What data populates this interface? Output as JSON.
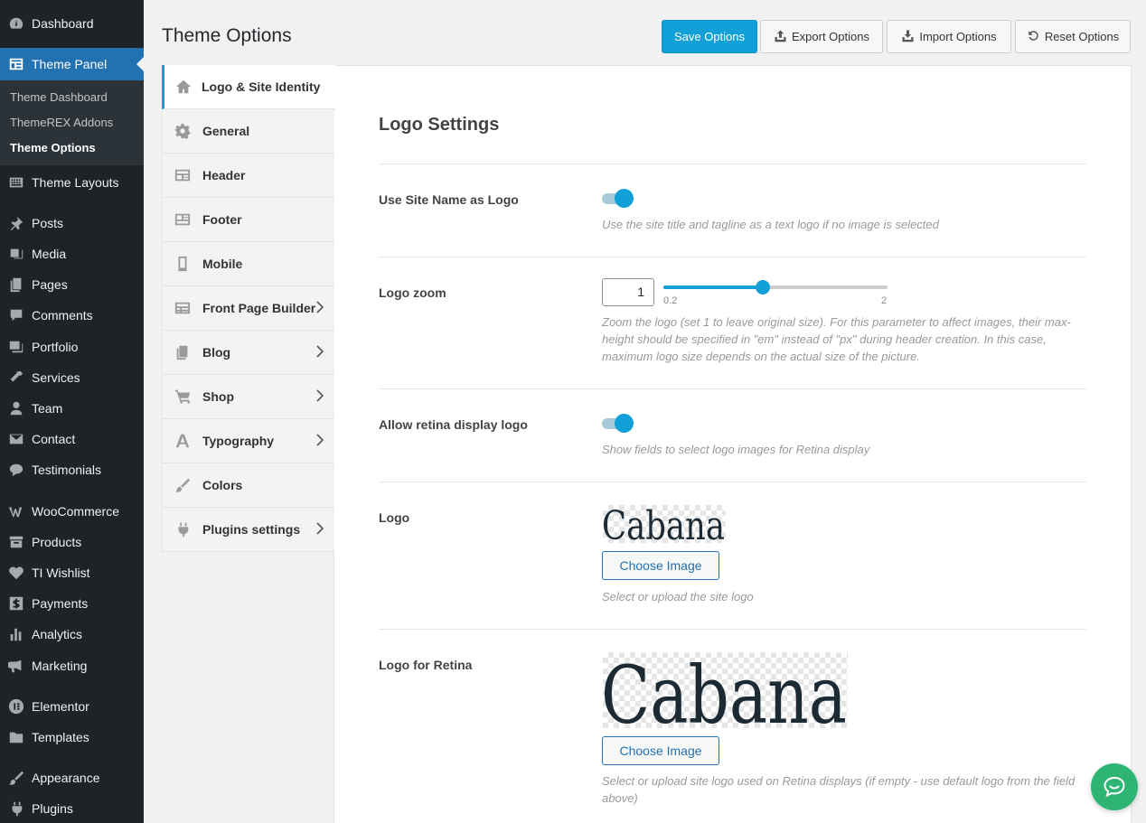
{
  "admin_menu": {
    "items": [
      {
        "label": "Dashboard",
        "icon": "dashboard-icon"
      },
      {
        "label": "Theme Panel",
        "icon": "theme-panel-icon"
      },
      {
        "label": "Theme Layouts",
        "icon": "layouts-icon"
      },
      {
        "label": "Posts",
        "icon": "pin-icon"
      },
      {
        "label": "Media",
        "icon": "media-icon"
      },
      {
        "label": "Pages",
        "icon": "pages-icon"
      },
      {
        "label": "Comments",
        "icon": "comment-icon"
      },
      {
        "label": "Portfolio",
        "icon": "portfolio-icon"
      },
      {
        "label": "Services",
        "icon": "tools-icon"
      },
      {
        "label": "Team",
        "icon": "user-icon"
      },
      {
        "label": "Contact",
        "icon": "envelope-icon"
      },
      {
        "label": "Testimonials",
        "icon": "chat-bubble-icon"
      },
      {
        "label": "WooCommerce",
        "icon": "woocommerce-icon"
      },
      {
        "label": "Products",
        "icon": "archive-icon"
      },
      {
        "label": "TI Wishlist",
        "icon": "heart-icon"
      },
      {
        "label": "Payments",
        "icon": "dollar-icon"
      },
      {
        "label": "Analytics",
        "icon": "bar-chart-icon"
      },
      {
        "label": "Marketing",
        "icon": "megaphone-icon"
      },
      {
        "label": "Elementor",
        "icon": "elementor-icon"
      },
      {
        "label": "Templates",
        "icon": "folder-icon"
      },
      {
        "label": "Appearance",
        "icon": "brush-icon"
      },
      {
        "label": "Plugins",
        "icon": "plug-icon"
      }
    ],
    "submenu": [
      "Theme Dashboard",
      "ThemeREX Addons",
      "Theme Options"
    ]
  },
  "header": {
    "title": "Theme Options",
    "save": "Save Options",
    "export": "Export Options",
    "import": "Import Options",
    "reset": "Reset Options"
  },
  "tabs": [
    {
      "label": "Logo & Site Identity",
      "icon": "home-icon"
    },
    {
      "label": "General",
      "icon": "gear-icon"
    },
    {
      "label": "Header",
      "icon": "header-layout-icon"
    },
    {
      "label": "Footer",
      "icon": "footer-layout-icon"
    },
    {
      "label": "Mobile",
      "icon": "mobile-icon"
    },
    {
      "label": "Front Page Builder",
      "icon": "grid-icon"
    },
    {
      "label": "Blog",
      "icon": "pages-icon"
    },
    {
      "label": "Shop",
      "icon": "cart-icon"
    },
    {
      "label": "Typography",
      "icon": "font-icon"
    },
    {
      "label": "Colors",
      "icon": "brush-icon"
    },
    {
      "label": "Plugins settings",
      "icon": "plug-icon"
    }
  ],
  "content": {
    "section_title": "Logo Settings",
    "site_name_logo": {
      "label": "Use Site Name as Logo",
      "enabled": true,
      "description": "Use the site title and tagline as a text logo if no image is selected"
    },
    "logo_zoom": {
      "label": "Logo zoom",
      "value": "1",
      "min": "0.2",
      "max": "2",
      "description": "Zoom the logo (set 1 to leave original size). For this parameter to affect images, their max-height should be specified in \"em\" instead of \"px\" during header creation. In this case, maximum logo size depends on the actual size of the picture."
    },
    "retina": {
      "label": "Allow retina display logo",
      "enabled": true,
      "description": "Show fields to select logo images for Retina display"
    },
    "logo": {
      "label": "Logo",
      "image_text": "Cabana",
      "button": "Choose Image",
      "description": "Select or upload the site logo"
    },
    "logo_retina": {
      "label": "Logo for Retina",
      "image_text": "Cabana",
      "button": "Choose Image",
      "description": "Select or upload site logo used on Retina displays (if empty - use default logo from the field above)"
    }
  },
  "colors": {
    "accent": "#11a0d7",
    "admin_bg": "#1d2327",
    "admin_active": "#2271b1",
    "chat": "#2eb574"
  }
}
